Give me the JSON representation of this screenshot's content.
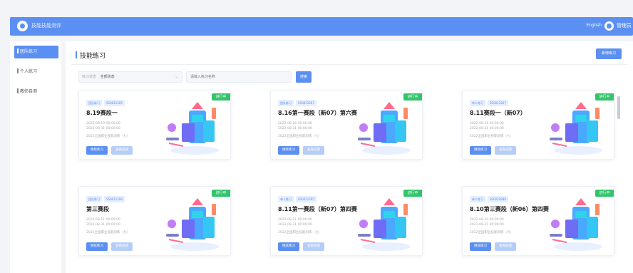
{
  "header": {
    "app_title": "技能技能测评",
    "language": "English",
    "user": "管理员"
  },
  "sidebar": {
    "items": [
      {
        "label": "团队练习",
        "active": true
      },
      {
        "label": "个人练习",
        "active": false
      },
      {
        "label": "教师自测",
        "active": false
      }
    ]
  },
  "main": {
    "page_title": "技能练习",
    "add_button": "新增练习",
    "filter": {
      "select_label": "练习状态",
      "select_value": "全部状态",
      "search_placeholder": "请输入练习名称",
      "search_button": "搜索"
    },
    "cards": [
      {
        "badge": "进行中",
        "tags": [
          "团队练习",
          "SS0021205"
        ],
        "title": "8.19赛段一",
        "date_start": "2022-08-19 00:00:00",
        "date_end": "2022-08-31 00:00:00",
        "desc": "2022全国职业技能训练（七）",
        "primary_label": "继续练习",
        "secondary_label": "查看成绩"
      },
      {
        "badge": "进行中",
        "tags": [
          "团队练习",
          "SS0021207"
        ],
        "title": "8.16第一赛段（新07）第六赛",
        "date_start": "2022-08-16 00:00:00",
        "date_end": "2022-08-31 00:00:00",
        "desc": "2022全国职业技能训练（七）",
        "primary_label": "继续练习",
        "secondary_label": "查看成绩"
      },
      {
        "badge": "进行中",
        "tags": [
          "单人练习",
          "SS0021207"
        ],
        "title": "8.11赛段一（新07）",
        "date_start": "2022-08-11 00:00:00",
        "date_end": "2022-08-31 00:00:00",
        "desc": "2022全国职业技能训练（七）",
        "primary_label": "继续练习",
        "secondary_label": "查看成绩"
      },
      {
        "badge": "进行中",
        "tags": [
          "团队练习",
          "SS0021206"
        ],
        "title": "第三赛段",
        "date_start": "2022-08-11 00:00:00",
        "date_end": "2022-08-31 00:00:00",
        "desc": "2022全国职业技能训练（七）",
        "primary_label": "继续练习",
        "secondary_label": "查看成绩"
      },
      {
        "badge": "进行中",
        "tags": [
          "单人练习",
          "SS0021205"
        ],
        "title": "8.11第一赛段（新07）第四赛",
        "date_start": "2022-08-11 00:00:00",
        "date_end": "2022-08-31 00:00:00",
        "desc": "2022全国职业技能训练（七）",
        "primary_label": "继续练习",
        "secondary_label": "查看成绩"
      },
      {
        "badge": "进行中",
        "tags": [
          "单人练习",
          "SS0020989"
        ],
        "title": "8.10第三赛段（新06）第四赛",
        "date_start": "2022-08-10 00:00:00",
        "date_end": "2022-08-31 00:00:00",
        "desc": "2022全国职业技能训练（六）",
        "primary_label": "继续练习",
        "secondary_label": "查看成绩"
      }
    ]
  },
  "colors": {
    "brand": "#5b8ff1",
    "status_active": "#33c36b",
    "secondary_button": "#b6cdf8"
  },
  "icons": [
    "logo-icon",
    "avatar-icon",
    "chevron-down-icon",
    "trophy-illustration"
  ]
}
